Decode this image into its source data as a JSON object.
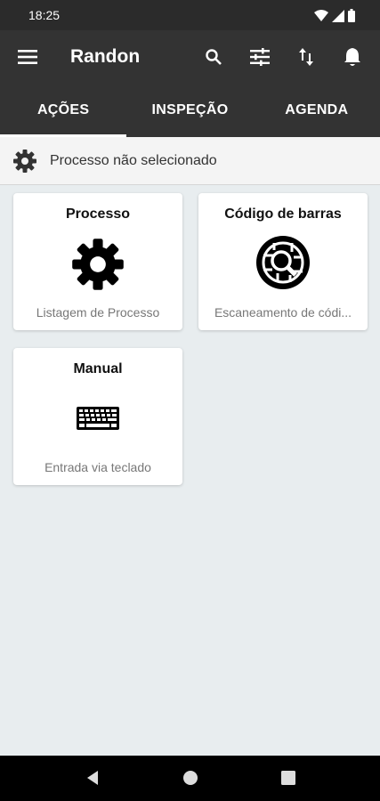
{
  "status_bar": {
    "time": "18:25"
  },
  "app_bar": {
    "title": "Randon",
    "icons": [
      "menu-icon",
      "search-icon",
      "tune-icon",
      "swap-vert-icon",
      "notifications-icon"
    ]
  },
  "tabs": [
    {
      "label": "AÇÕES",
      "active": true
    },
    {
      "label": "INSPEÇÃO",
      "active": false
    },
    {
      "label": "AGENDA",
      "active": false
    }
  ],
  "process_status": {
    "text": "Processo não selecionado",
    "icon": "gear-icon"
  },
  "cards": [
    {
      "title": "Processo",
      "subtitle": "Listagem de Processo",
      "icon": "gear-icon"
    },
    {
      "title": "Código de barras",
      "subtitle": "Escaneamento de códi...",
      "icon": "qr-scan-icon"
    },
    {
      "title": "Manual",
      "subtitle": "Entrada via teclado",
      "icon": "keyboard-icon"
    }
  ],
  "colors": {
    "app_bar": "#333333",
    "background": "#e8edef",
    "card": "#ffffff"
  }
}
